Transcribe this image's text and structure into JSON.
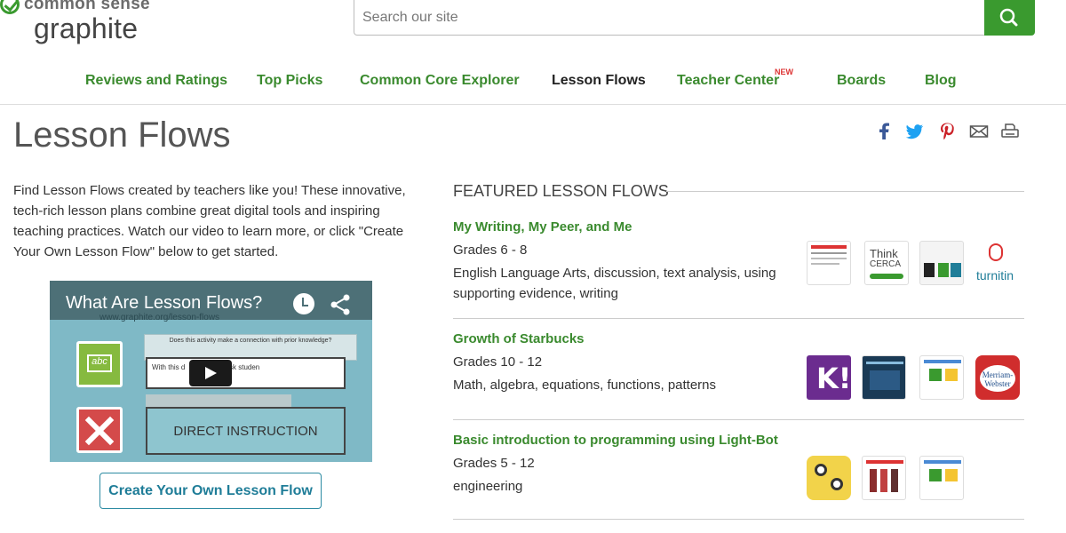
{
  "brand": {
    "line1": "common sense",
    "line2": "graphite"
  },
  "search": {
    "placeholder": "Search our site"
  },
  "nav": {
    "items": [
      "Reviews and Ratings",
      "Top Picks",
      "Common Core Explorer",
      "Lesson Flows",
      "Teacher Center",
      "Boards",
      "Blog"
    ],
    "new_badge": "NEW",
    "active": "Lesson Flows"
  },
  "page": {
    "title": "Lesson Flows",
    "intro": "Find Lesson Flows created by teachers like you! These innovative, tech-rich lesson plans combine great digital tools and inspiring teaching practices. Watch our video to learn more, or click \"Create Your Own Lesson Flow\" below to get started."
  },
  "share_icons": [
    "facebook-icon",
    "twitter-icon",
    "pinterest-icon",
    "email-icon",
    "print-icon"
  ],
  "video": {
    "title": "What Are Lesson Flows?",
    "url": "www.graphite.org/lesson-flows",
    "question": "Does this activity make a connection with prior knowledge?",
    "input_text": "With this d",
    "input_text_tail": "sk studen",
    "abc": "abc",
    "direct": "DIRECT INSTRUCTION"
  },
  "cta": {
    "label": "Create Your Own Lesson Flow"
  },
  "featured": {
    "heading": "FEATURED LESSON FLOWS",
    "flows": [
      {
        "title": "My Writing, My Peer, and Me",
        "grades": "Grades 6 - 8",
        "subjects": "English Language Arts, discussion, text analysis, using supporting evidence, writing",
        "tools": [
          "Today's Meet",
          "Think CERCA",
          "teacher paper",
          "turnitin"
        ]
      },
      {
        "title": "Growth of Starbucks",
        "grades": "Grades 10 - 12",
        "subjects": "Math, algebra, equations, functions, patterns",
        "tools": [
          "K!",
          "Instant Audience Feedback",
          "spreadsheet",
          "Merriam-Webster"
        ]
      },
      {
        "title": "Basic introduction to programming using Light-Bot",
        "grades": "Grades 5 - 12",
        "subjects": "engineering",
        "tools": [
          "Light-Bot",
          "video",
          "spreadsheet"
        ]
      }
    ]
  },
  "colors": {
    "green": "#3a9a2f",
    "link": "#3a8a2e",
    "teal": "#1f7d98",
    "facebook": "#3b5998",
    "twitter": "#1da1f2",
    "pinterest": "#cb2027"
  }
}
